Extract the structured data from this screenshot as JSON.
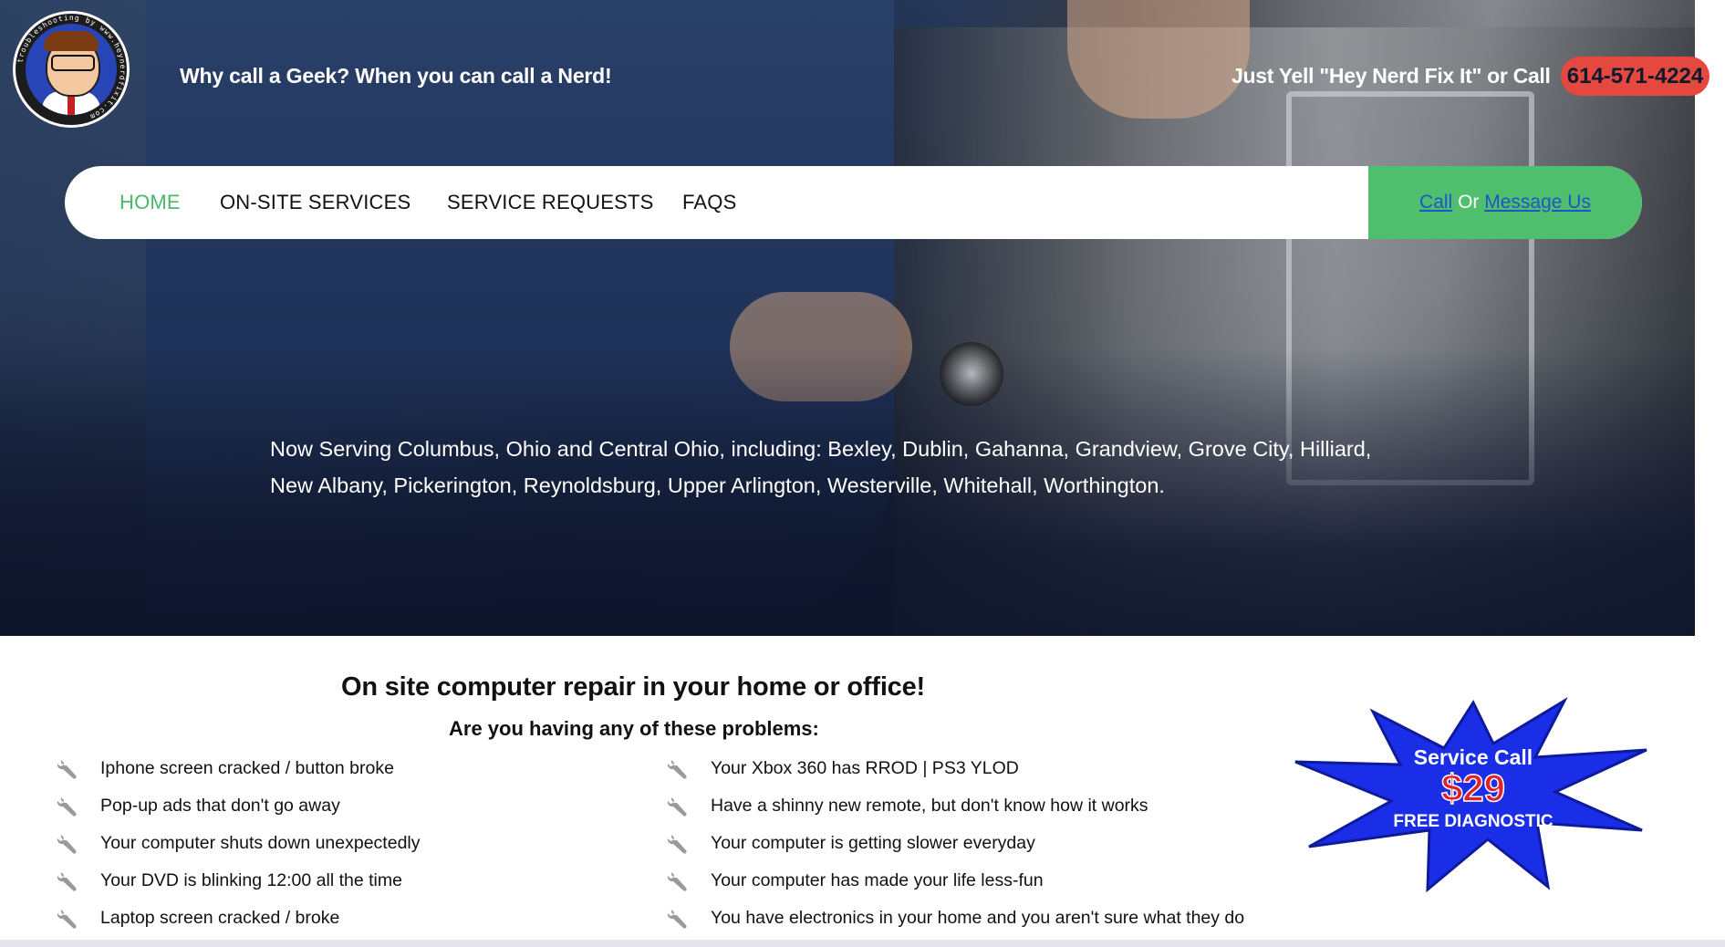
{
  "header": {
    "logo_text": "troubleshooting by www.heynerdfixit.com",
    "tagline": "Why call a Geek? When you can call a Nerd!",
    "yell_text": "Just Yell \"Hey Nerd Fix It\" or Call",
    "phone": "614-571-4224"
  },
  "nav": {
    "items": [
      {
        "label": "HOME"
      },
      {
        "label": "ON-SITE SERVICES"
      },
      {
        "label": "SERVICE REQUESTS"
      },
      {
        "label": "FAQS"
      }
    ],
    "cta_call": "Call",
    "cta_or": " Or ",
    "cta_message": "Message Us"
  },
  "hero": {
    "serving_line1": "Now Serving Columbus, Ohio and Central Ohio, including: Bexley, Dublin, Gahanna, Grandview, Grove City, Hilliard,",
    "serving_line2": "New Albany, Pickerington, Reynoldsburg, Upper Arlington, Westerville, Whitehall, Worthington."
  },
  "main": {
    "heading": "On site computer repair in your home or office!",
    "subheading": "Are you having any of these problems:",
    "problems_left": [
      "Iphone screen cracked / button broke",
      "Pop-up ads that don't go away",
      "Your computer shuts down unexpectedly",
      "Your DVD is blinking 12:00 all the time",
      "Laptop screen cracked / broke"
    ],
    "problems_right": [
      "Your Xbox 360 has RROD | PS3 YLOD",
      "Have a shinny new remote, but don't know how it works",
      "Your computer is getting slower everyday",
      "Your computer has made your life less-fun",
      "You have electronics in your home and you aren't sure what they do"
    ]
  },
  "promo": {
    "line1": "Service Call",
    "price": "$29",
    "line2": "FREE DIAGNOSTIC",
    "colors": {
      "burst": "#1a2ee8",
      "price": "#e0202a",
      "text": "#ffffff"
    }
  },
  "colors": {
    "accent_green": "#4bb86a",
    "phone_red": "#e5483f",
    "link_blue": "#1b57c9"
  }
}
